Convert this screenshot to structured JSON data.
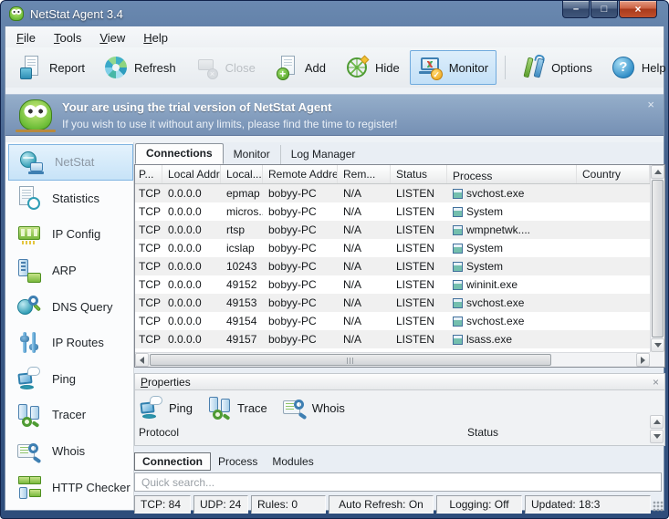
{
  "window": {
    "title": "NetStat Agent 3.4"
  },
  "caption_buttons": [
    {
      "glyph": "–",
      "cls": "cap-min",
      "name": "minimize-button"
    },
    {
      "glyph": "□",
      "cls": "cap-max",
      "name": "maximize-button"
    },
    {
      "glyph": "×",
      "cls": "cap-close",
      "name": "close-button"
    }
  ],
  "menu": {
    "items": [
      {
        "u": "F",
        "rest": "ile",
        "name": "menu-file"
      },
      {
        "u": "T",
        "rest": "ools",
        "name": "menu-tools"
      },
      {
        "u": "V",
        "rest": "iew",
        "name": "menu-view"
      },
      {
        "u": "H",
        "rest": "elp",
        "name": "menu-help"
      }
    ]
  },
  "toolbar": {
    "items": [
      {
        "label": "Report",
        "icon": "icon-report",
        "icon_name": "report-icon",
        "cls": ""
      },
      {
        "label": "Refresh",
        "icon": "icon-refresh",
        "icon_name": "refresh-icon",
        "cls": ""
      },
      {
        "label": "Close",
        "icon": "icon-close-session",
        "icon_name": "close-session-icon",
        "cls": "disabled"
      },
      {
        "label": "Add",
        "icon": "icon-add",
        "icon_name": "add-icon",
        "cls": ""
      },
      {
        "label": "Hide",
        "icon": "icon-hide",
        "icon_name": "hide-icon",
        "cls": ""
      },
      {
        "label": "Monitor",
        "icon": "icon-monitor",
        "icon_name": "monitor-icon",
        "cls": "active"
      },
      {
        "label": "Options",
        "icon": "icon-options",
        "icon_name": "options-icon",
        "cls": "with-sep"
      },
      {
        "label": "Help",
        "icon": "icon-help",
        "icon_name": "help-icon",
        "cls": ""
      }
    ]
  },
  "banner": {
    "title": "Your are using the trial version of NetStat Agent",
    "subtitle": "If you wish to use it without any limits, please find the time to register!",
    "close": "×"
  },
  "sidebar": {
    "items": [
      {
        "label": "NetStat",
        "icon": "icon-netstat",
        "icon_name": "netstat-icon",
        "cls": "active"
      },
      {
        "label": "Statistics",
        "icon": "icon-stats",
        "icon_name": "statistics-icon",
        "cls": ""
      },
      {
        "label": "IP Config",
        "icon": "icon-ipconfig",
        "icon_name": "ip-config-icon",
        "cls": ""
      },
      {
        "label": "ARP",
        "icon": "icon-arp",
        "icon_name": "arp-icon",
        "cls": ""
      },
      {
        "label": "DNS Query",
        "icon": "icon-dns",
        "icon_name": "dns-query-icon",
        "cls": ""
      },
      {
        "label": "IP Routes",
        "icon": "icon-iproutes",
        "icon_name": "ip-routes-icon",
        "cls": ""
      },
      {
        "label": "Ping",
        "icon": "icon-ping",
        "icon_name": "ping-icon",
        "cls": ""
      },
      {
        "label": "Tracer",
        "icon": "icon-tracer",
        "icon_name": "tracer-icon",
        "cls": ""
      },
      {
        "label": "Whois",
        "icon": "icon-whois",
        "icon_name": "whois-icon",
        "cls": ""
      },
      {
        "label": "HTTP Checker",
        "icon": "icon-http",
        "icon_name": "http-checker-icon",
        "cls": ""
      }
    ]
  },
  "tabs": {
    "items": [
      {
        "label": "Connections",
        "cls": "active"
      },
      {
        "label": "Monitor",
        "cls": ""
      },
      {
        "label": "Log Manager",
        "cls": ""
      }
    ]
  },
  "table": {
    "headers": [
      "P...",
      "Local Addr...",
      "Local...",
      "Remote Address",
      "Rem...",
      "Status",
      "Process",
      "Country"
    ],
    "rows": [
      {
        "protocol": "TCP",
        "local_address": "0.0.0.0",
        "local_port": "epmap",
        "remote_address": "bobyy-PC",
        "remote_port": "N/A",
        "status": "LISTEN",
        "process": "svchost.exe",
        "country": ""
      },
      {
        "protocol": "TCP",
        "local_address": "0.0.0.0",
        "local_port": "micros...",
        "remote_address": "bobyy-PC",
        "remote_port": "N/A",
        "status": "LISTEN",
        "process": "System",
        "country": ""
      },
      {
        "protocol": "TCP",
        "local_address": "0.0.0.0",
        "local_port": "rtsp",
        "remote_address": "bobyy-PC",
        "remote_port": "N/A",
        "status": "LISTEN",
        "process": "wmpnetwk....",
        "country": ""
      },
      {
        "protocol": "TCP",
        "local_address": "0.0.0.0",
        "local_port": "icslap",
        "remote_address": "bobyy-PC",
        "remote_port": "N/A",
        "status": "LISTEN",
        "process": "System",
        "country": ""
      },
      {
        "protocol": "TCP",
        "local_address": "0.0.0.0",
        "local_port": "10243",
        "remote_address": "bobyy-PC",
        "remote_port": "N/A",
        "status": "LISTEN",
        "process": "System",
        "country": ""
      },
      {
        "protocol": "TCP",
        "local_address": "0.0.0.0",
        "local_port": "49152",
        "remote_address": "bobyy-PC",
        "remote_port": "N/A",
        "status": "LISTEN",
        "process": "wininit.exe",
        "country": ""
      },
      {
        "protocol": "TCP",
        "local_address": "0.0.0.0",
        "local_port": "49153",
        "remote_address": "bobyy-PC",
        "remote_port": "N/A",
        "status": "LISTEN",
        "process": "svchost.exe",
        "country": ""
      },
      {
        "protocol": "TCP",
        "local_address": "0.0.0.0",
        "local_port": "49154",
        "remote_address": "bobyy-PC",
        "remote_port": "N/A",
        "status": "LISTEN",
        "process": "svchost.exe",
        "country": ""
      },
      {
        "protocol": "TCP",
        "local_address": "0.0.0.0",
        "local_port": "49157",
        "remote_address": "bobyy-PC",
        "remote_port": "N/A",
        "status": "LISTEN",
        "process": "lsass.exe",
        "country": ""
      }
    ]
  },
  "properties": {
    "title_u": "P",
    "title_rest": "roperties",
    "close": "×",
    "buttons": [
      {
        "label": "Ping",
        "icon": "icon-ping",
        "icon_name": "ping-tool-icon"
      },
      {
        "label": "Trace",
        "icon": "icon-tracer",
        "icon_name": "trace-tool-icon"
      },
      {
        "label": "Whois",
        "icon": "icon-whois",
        "icon_name": "whois-tool-icon"
      }
    ],
    "field_labels": {
      "protocol": "Protocol",
      "status": "Status"
    }
  },
  "subtabs": {
    "items": [
      {
        "label": "Connection",
        "cls": "active"
      },
      {
        "label": "Process",
        "cls": ""
      },
      {
        "label": "Modules",
        "cls": ""
      }
    ]
  },
  "search": {
    "placeholder": "Quick search..."
  },
  "statusbar": {
    "items": [
      {
        "label": "TCP: 84",
        "cls": "seg-tcp"
      },
      {
        "label": "UDP: 24",
        "cls": "seg-udp"
      },
      {
        "label": "Rules: 0",
        "cls": "seg-rules"
      },
      {
        "label": "Auto Refresh: On",
        "cls": "seg-auto"
      },
      {
        "label": "Logging: Off",
        "cls": "seg-log"
      },
      {
        "label": "Updated: 18:3",
        "cls": "seg-upd"
      }
    ]
  },
  "colors": {
    "titlebar": "#44618c",
    "banner": "#7e9cc0",
    "selection": "#c7e3f8",
    "close_button": "#a93a1c"
  }
}
